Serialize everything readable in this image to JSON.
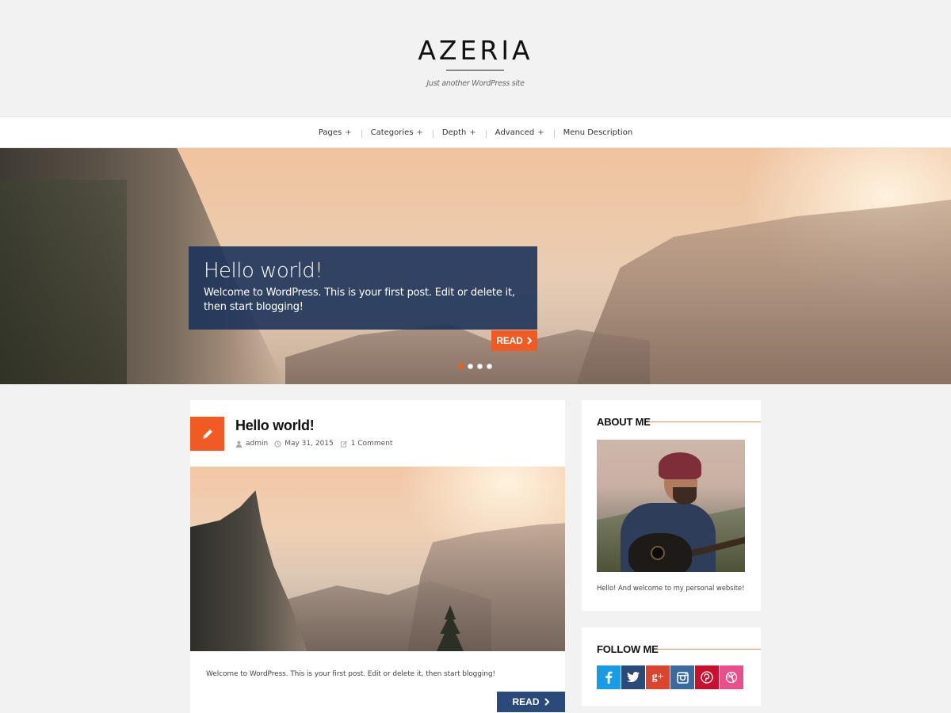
{
  "site": {
    "title": "AZERIA",
    "tagline": "Just another WordPress site"
  },
  "nav": {
    "items": [
      {
        "label": "Pages",
        "plus": "+"
      },
      {
        "label": "Categories",
        "plus": "+"
      },
      {
        "label": "Depth",
        "plus": "+"
      },
      {
        "label": "Advanced",
        "plus": "+"
      },
      {
        "label": "Menu Description",
        "plus": ""
      }
    ]
  },
  "hero": {
    "title": "Hello world!",
    "excerpt": "Welcome to WordPress. This is your first post. Edit or delete it, then start blogging!",
    "read_label": "READ",
    "slides": 4,
    "active_slide": 1
  },
  "post": {
    "title": "Hello world!",
    "author": "admin",
    "date": "May 31, 2015",
    "comments": "1 Comment",
    "excerpt": "Welcome to WordPress. This is your first post. Edit or delete it, then start blogging!",
    "read_label": "READ",
    "format_icon": "pencil-icon"
  },
  "sidebar": {
    "about": {
      "title": "ABOUT ME",
      "text": "Hello! And welcome to my personal website!"
    },
    "follow": {
      "title": "FOLLOW ME",
      "networks": [
        {
          "name": "facebook",
          "color": "#1a9be6",
          "glyph": "f"
        },
        {
          "name": "twitter",
          "color": "#2a4a7b",
          "glyph": "t"
        },
        {
          "name": "google-plus",
          "color": "#d9452e",
          "glyph": "g+"
        },
        {
          "name": "instagram",
          "color": "#3a6aa0",
          "glyph": "ig"
        },
        {
          "name": "pinterest",
          "color": "#c8102e",
          "glyph": "p"
        },
        {
          "name": "dribbble",
          "color": "#e94f8b",
          "glyph": "d"
        }
      ]
    }
  },
  "colors": {
    "accent": "#f15a22",
    "primary": "#2a4a7b",
    "background": "#f2f2f2"
  }
}
